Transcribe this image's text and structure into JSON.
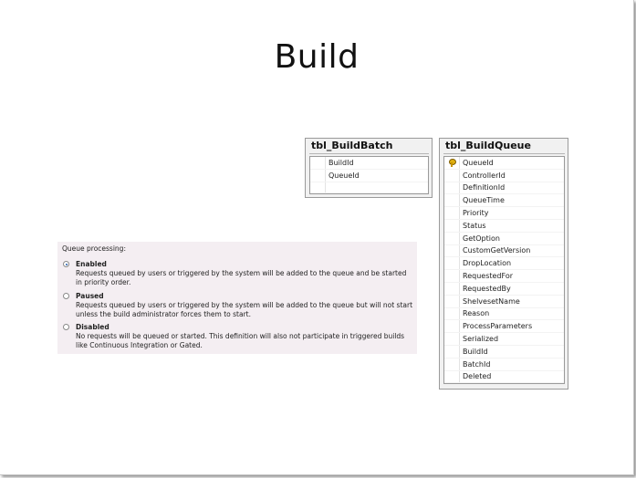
{
  "slide": {
    "title": "Build"
  },
  "build_batch_table": {
    "name": "tbl_BuildBatch",
    "columns": [
      "BuildId",
      "QueueId"
    ]
  },
  "build_queue_table": {
    "name": "tbl_BuildQueue",
    "primary_key_icon": "key-icon",
    "columns": [
      "QueueId",
      "ControllerId",
      "DefinitionId",
      "QueueTime",
      "Priority",
      "Status",
      "GetOption",
      "CustomGetVersion",
      "DropLocation",
      "RequestedFor",
      "RequestedBy",
      "ShelvesetName",
      "Reason",
      "ProcessParameters",
      "Serialized",
      "BuildId",
      "BatchId",
      "Deleted"
    ]
  },
  "queue_processing": {
    "label": "Queue processing:",
    "selected": "Enabled",
    "options": [
      {
        "name": "Enabled",
        "description": "Requests queued by users or triggered by the system will be added to the queue and be started in priority order."
      },
      {
        "name": "Paused",
        "description": "Requests queued by users or triggered by the system will be added to the queue but will not start unless the build administrator forces them to start."
      },
      {
        "name": "Disabled",
        "description": "No requests will be queued or started. This definition will also not participate in triggered builds like Continuous Integration or Gated."
      }
    ]
  }
}
